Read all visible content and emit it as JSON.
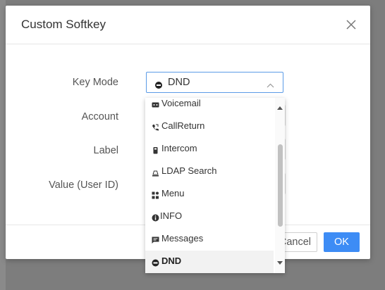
{
  "dialog": {
    "title": "Custom Softkey",
    "close_icon": "close-icon"
  },
  "form": {
    "key_mode_label": "Key Mode",
    "key_mode_value": "DND",
    "account_label": "Account",
    "label_label": "Label",
    "value_label": "Value (User ID)"
  },
  "dropdown": {
    "options": [
      {
        "label": "Voicemail",
        "icon": "voicemail-icon"
      },
      {
        "label": "CallReturn",
        "icon": "call-return-icon"
      },
      {
        "label": "Intercom",
        "icon": "intercom-icon"
      },
      {
        "label": "LDAP Search",
        "icon": "ldap-search-icon"
      },
      {
        "label": "Menu",
        "icon": "menu-icon"
      },
      {
        "label": "INFO",
        "icon": "info-icon"
      },
      {
        "label": "Messages",
        "icon": "messages-icon"
      },
      {
        "label": "DND",
        "icon": "dnd-icon"
      }
    ],
    "selected": "DND"
  },
  "footer": {
    "cancel_label": "Cancel",
    "ok_label": "OK"
  },
  "colors": {
    "accent": "#3d8cf5",
    "overlay": "#7d7d7d"
  }
}
